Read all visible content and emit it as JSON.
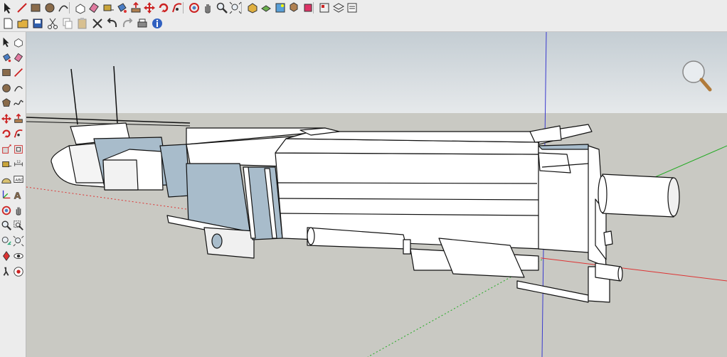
{
  "toolbar_top": {
    "icons": [
      "select-icon",
      "pencil-line-icon",
      "rectangle-icon",
      "circle-icon",
      "arc-icon",
      "make-component-icon",
      "eraser-icon",
      "tape-measure-icon",
      "paint-bucket-icon",
      "push-pull-icon",
      "move-icon",
      "rotate-icon",
      "follow-me-icon",
      "orbit-icon",
      "pan-icon",
      "zoom-icon",
      "zoom-extents-icon",
      "3d-warehouse-icon",
      "share-model-icon",
      "photo-textures-icon",
      "get-models-icon",
      "extension-warehouse-icon",
      "styles-icon",
      "layers-icon",
      "outliner-icon"
    ]
  },
  "toolbar_second": {
    "icons": [
      "new-file-icon",
      "open-file-icon",
      "save-icon",
      "cut-icon",
      "copy-icon",
      "paste-icon",
      "delete-icon",
      "undo-icon",
      "redo-icon",
      "print-icon",
      "model-info-icon"
    ]
  },
  "side_toolbar": {
    "icons": [
      "select-icon",
      "make-component-icon",
      "paint-bucket-icon",
      "eraser-icon",
      "rectangle-icon",
      "line-icon",
      "circle-icon",
      "arc-icon",
      "polygon-icon",
      "freehand-icon",
      "move-icon",
      "push-pull-icon",
      "rotate-icon",
      "follow-me-icon",
      "scale-icon",
      "offset-icon",
      "tape-measure-icon",
      "dimension-icon",
      "protractor-icon",
      "text-icon",
      "axes-icon",
      "3d-text-icon",
      "orbit-icon",
      "pan-icon",
      "zoom-icon",
      "zoom-window-icon",
      "previous-view-icon",
      "zoom-extents-icon",
      "position-camera-icon",
      "look-around-icon",
      "walk-icon",
      "section-plane-icon"
    ]
  },
  "colors": {
    "sky": "#d6dde2",
    "ground": "#c9c9c3",
    "red_axis": "#d33",
    "green_axis": "#2a2",
    "blue_axis": "#33c",
    "model_face": "#ffffff",
    "model_back_face": "#a8bccb"
  }
}
